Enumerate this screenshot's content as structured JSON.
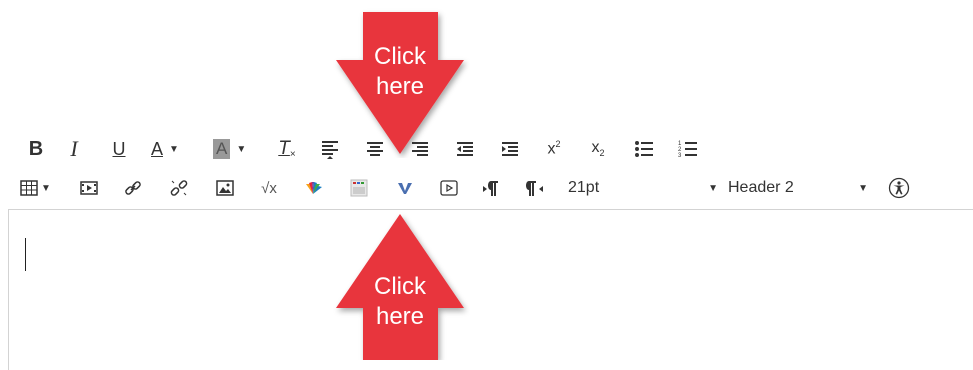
{
  "toolbar_row1": [
    {
      "name": "bold-button",
      "icon": "bold-icon",
      "text": "B"
    },
    {
      "name": "italic-button",
      "icon": "italic-icon",
      "text": "I"
    },
    {
      "name": "underline-button",
      "icon": "underline-icon",
      "text": "U"
    },
    {
      "name": "font-color-button",
      "icon": "font-color-icon",
      "text": "A"
    },
    {
      "name": "background-color-button",
      "icon": "background-color-icon",
      "text": "A"
    },
    {
      "name": "clear-formatting-button",
      "icon": "clear-formatting-icon",
      "text": "T"
    },
    {
      "name": "align-left-button",
      "icon": "align-left-icon"
    },
    {
      "name": "align-center-button",
      "icon": "align-center-icon"
    },
    {
      "name": "align-right-button",
      "icon": "align-right-icon"
    },
    {
      "name": "outdent-button",
      "icon": "outdent-icon"
    },
    {
      "name": "indent-button",
      "icon": "indent-icon"
    },
    {
      "name": "superscript-button",
      "icon": "superscript-icon",
      "text": "x",
      "sup": "2"
    },
    {
      "name": "subscript-button",
      "icon": "subscript-icon",
      "text": "x",
      "sub": "2"
    },
    {
      "name": "bullet-list-button",
      "icon": "bullet-list-icon"
    },
    {
      "name": "numbered-list-button",
      "icon": "numbered-list-icon"
    }
  ],
  "toolbar_row2": [
    {
      "name": "table-button",
      "icon": "table-icon"
    },
    {
      "name": "media-button",
      "icon": "media-icon"
    },
    {
      "name": "link-button",
      "icon": "link-icon"
    },
    {
      "name": "unlink-button",
      "icon": "unlink-icon"
    },
    {
      "name": "image-button",
      "icon": "image-icon"
    },
    {
      "name": "equation-button",
      "icon": "equation-icon",
      "text": "√x"
    },
    {
      "name": "nbc-button",
      "icon": "nbc-peacock-icon"
    },
    {
      "name": "embed-button",
      "icon": "embed-icon"
    },
    {
      "name": "vimeo-button",
      "icon": "v-logo-icon"
    },
    {
      "name": "video-button",
      "icon": "video-icon"
    },
    {
      "name": "ltr-button",
      "icon": "ltr-paragraph-icon"
    },
    {
      "name": "rtl-button",
      "icon": "rtl-paragraph-icon"
    }
  ],
  "font_size": {
    "value": "21pt"
  },
  "format": {
    "value": "Header 2"
  },
  "accessibility": {
    "icon": "accessibility-icon"
  },
  "callout_top": {
    "line1": "Click",
    "line2": "here",
    "color": "#e8343c"
  },
  "callout_bottom": {
    "line1": "Click",
    "line2": "here",
    "color": "#e8343c"
  }
}
